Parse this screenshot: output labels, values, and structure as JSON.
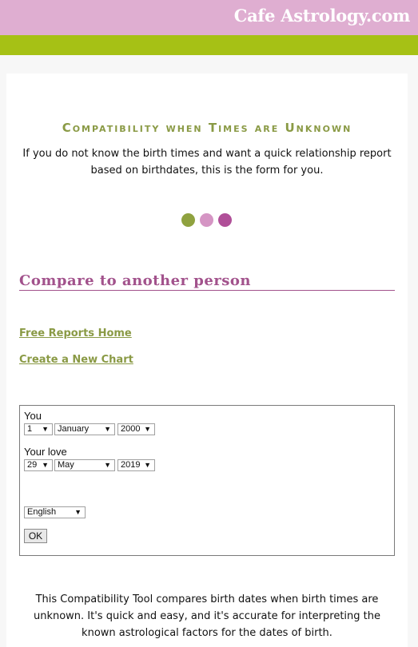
{
  "header": {
    "logo": "Cafe Astrology.com",
    "colors": {
      "pink": "#dfaed1",
      "green": "#a6c115"
    }
  },
  "page": {
    "title": "Compatibility when Times are Unknown",
    "intro": "If you do not know the birth times and want a quick relationship report based on birthdates, this is the form for you.",
    "dots": [
      {
        "name": "green-dot",
        "color": "#8fa23f"
      },
      {
        "name": "pink-dot",
        "color": "#d595c4"
      },
      {
        "name": "magenta-dot",
        "color": "#b04f98"
      }
    ],
    "section_title": "Compare to another person",
    "links": [
      {
        "label": "Free Reports Home"
      },
      {
        "label": "Create a New Chart"
      }
    ]
  },
  "form": {
    "you_label": "You",
    "you": {
      "day": "1",
      "month": "January",
      "year": "2000"
    },
    "love_label": "Your love",
    "love": {
      "day": "29",
      "month": "May",
      "year": "2019"
    },
    "language": "English",
    "submit_label": "OK",
    "arrow_glyph": "▼"
  },
  "footer": {
    "text": "This Compatibility Tool compares birth dates when birth times are unknown. It's quick and easy, and it's accurate for interpreting the known astrological factors for the dates of birth."
  }
}
